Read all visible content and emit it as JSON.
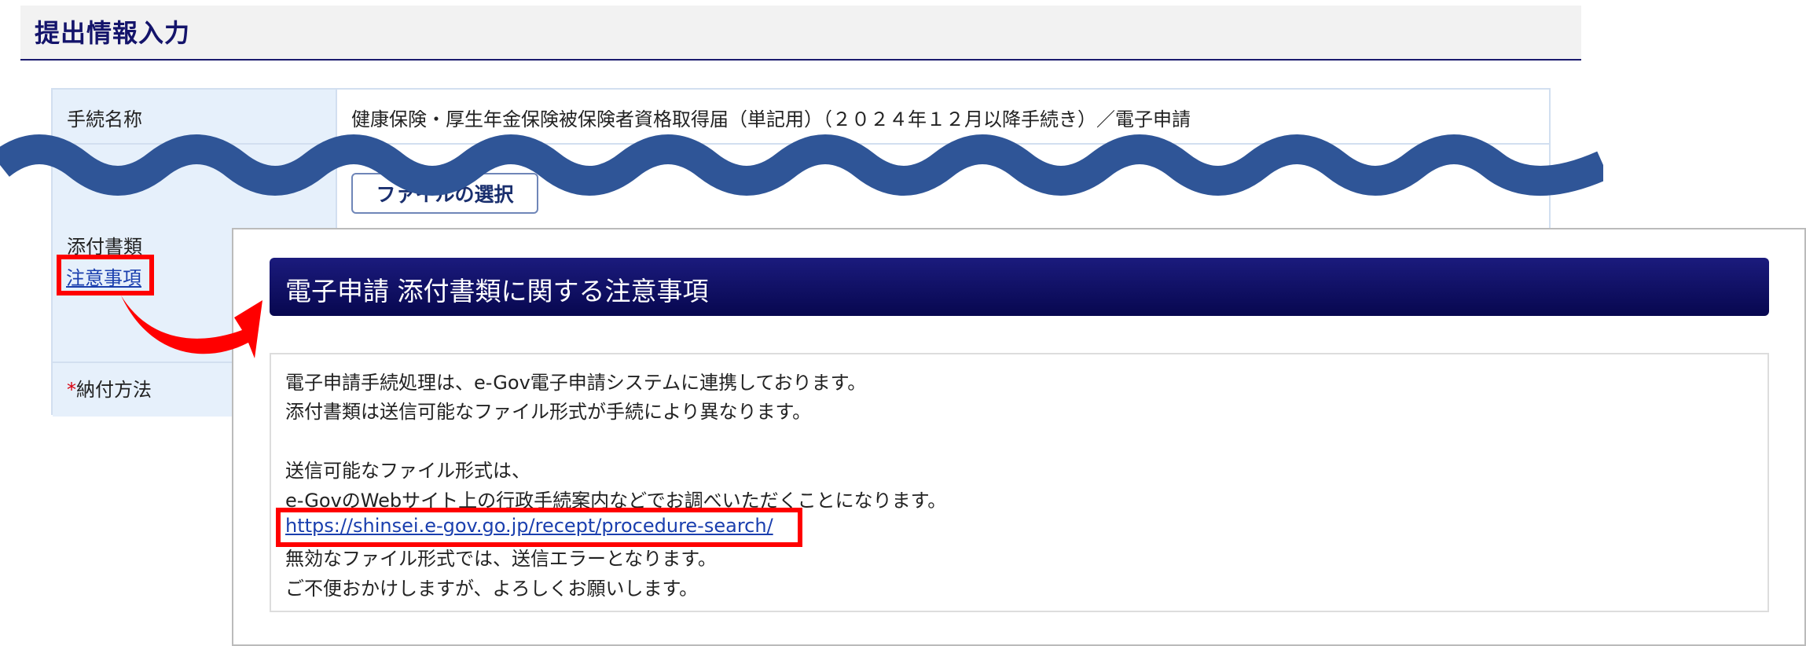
{
  "header": {
    "title": "提出情報入力"
  },
  "form": {
    "procedure": {
      "label": "手続名称",
      "value": "健康保険・厚生年金保険被保険者資格取得届（単記用）（２０２４年１２月以降手続き）／電子申請"
    },
    "attachments": {
      "label": "添付書類",
      "notes_link": "注意事項",
      "file_button": "ファイルの選択"
    },
    "payment": {
      "required_mark": "*",
      "label": "納付方法"
    }
  },
  "modal": {
    "title": "電子申請 添付書類に関する注意事項",
    "lines": [
      "電子申請手続処理は、e-Gov電子申請システムに連携しております。",
      "添付書類は送信可能なファイル形式が手続により異なります。",
      "送信可能なファイル形式は、",
      "e-GovのWebサイト上の行政手続案内などでお調べいただくことになります。"
    ],
    "link": "https://shinsei.e-gov.go.jp/recept/procedure-search/",
    "after_lines": [
      "無効なファイル形式では、送信エラーとなります。",
      "ご不便おかけしますが、よろしくお願いします。"
    ]
  },
  "colors": {
    "header_text": "#14146b",
    "modal_header": "#0b0b5c",
    "link": "#1a3fae",
    "highlight": "#ff0000",
    "wave": "#2f5597",
    "required": "#d8000f"
  }
}
